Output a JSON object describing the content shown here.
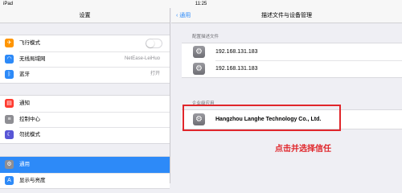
{
  "statusbar": {
    "device": "iPad",
    "time": "11:25"
  },
  "left": {
    "title": "设置",
    "group1": [
      {
        "label": "飞行模式",
        "icon": "airplane-icon",
        "color": "#ff9500",
        "toggle": "off"
      },
      {
        "label": "无线局域网",
        "icon": "wifi-icon",
        "color": "#2d8af8",
        "value": "NetEase-LeiHuo"
      },
      {
        "label": "蓝牙",
        "icon": "bluetooth-icon",
        "color": "#2d8af8",
        "value": "打开"
      }
    ],
    "group2": [
      {
        "label": "通知",
        "icon": "notifications-icon",
        "color": "#ff3b30"
      },
      {
        "label": "控制中心",
        "icon": "control-center-icon",
        "color": "#8e8e93"
      },
      {
        "label": "勿扰模式",
        "icon": "moon-icon",
        "color": "#5856d6"
      }
    ],
    "group3": [
      {
        "label": "通用",
        "icon": "gear-icon",
        "color": "#8e8e93",
        "selected": true
      },
      {
        "label": "显示与亮度",
        "icon": "display-icon",
        "color": "#2d8af8"
      }
    ]
  },
  "right": {
    "back_label": "通用",
    "title": "描述文件与设备管理",
    "section_profiles": "配置描述文件",
    "profiles": [
      "192.168.131.183",
      "192.168.131.183"
    ],
    "section_enterprise": "企业级应用",
    "enterprise_app": "Hangzhou Langhe Technology Co., Ltd."
  },
  "annotation": {
    "hint": "点击并选择信任",
    "color": "#e0262b"
  }
}
